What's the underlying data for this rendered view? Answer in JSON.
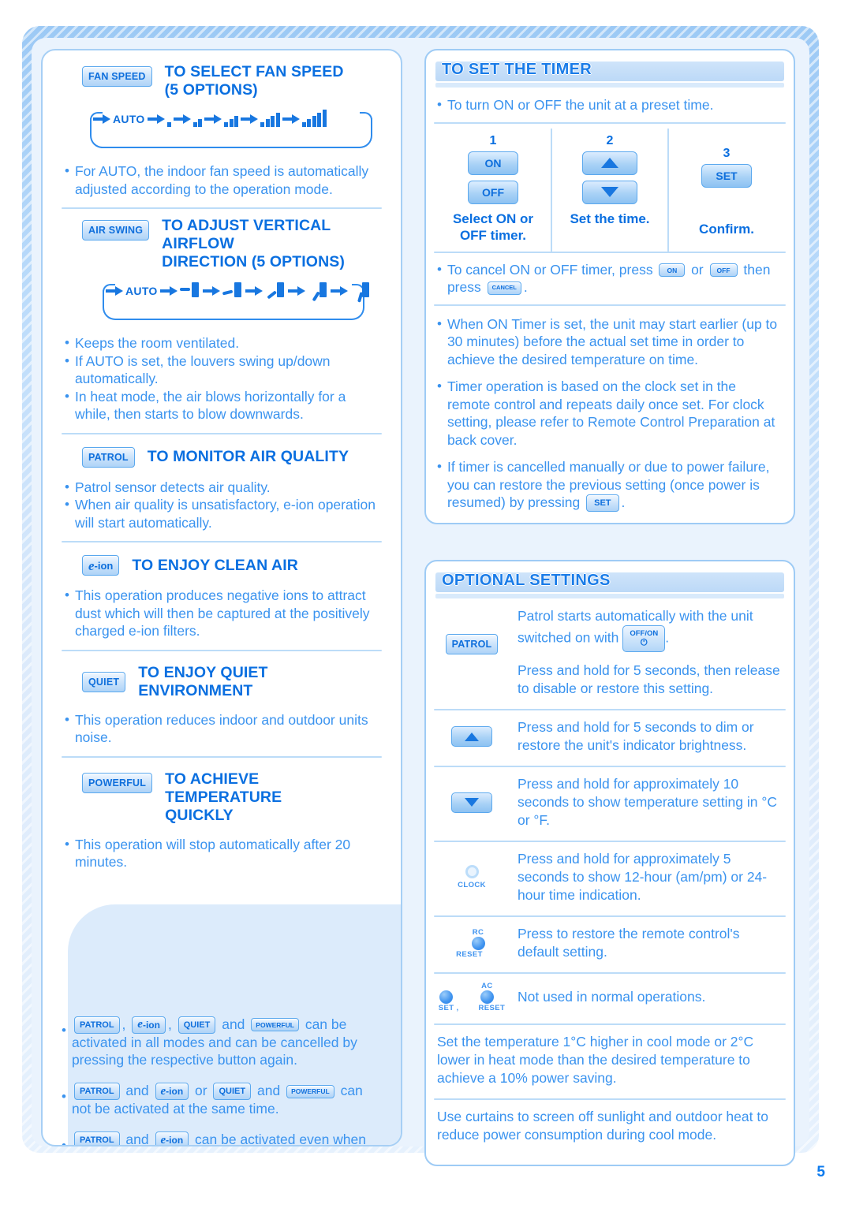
{
  "page": {
    "number": "5"
  },
  "left_column": {
    "sections": [
      {
        "id": "fan-speed",
        "button_label": "FAN SPEED",
        "heading_line1": "TO SELECT FAN SPEED",
        "heading_line2": "(5 OPTIONS)",
        "flow_auto_label": "AUTO",
        "flow_steps": 5,
        "bullets": [
          "For AUTO, the indoor fan speed is automatically adjusted according to the operation mode."
        ]
      },
      {
        "id": "air-swing",
        "button_label": "AIR SWING",
        "heading_line1": "TO ADJUST VERTICAL AIRFLOW",
        "heading_line2": "DIRECTION  (5 OPTIONS)",
        "flow_auto_label": "AUTO",
        "flow_steps": 5,
        "bullets": [
          "Keeps the room ventilated.",
          "If AUTO is set, the louvers swing up/down automatically.",
          "In heat mode, the air blows horizontally for a while, then starts to blow downwards."
        ]
      },
      {
        "id": "patrol",
        "button_label": "PATROL",
        "heading_line1": "TO MONITOR AIR QUALITY",
        "bullets": [
          "Patrol sensor detects air quality.",
          "When air quality is unsatisfactory, e-ion operation will start automatically."
        ]
      },
      {
        "id": "e-ion",
        "button_label": "e-ion",
        "heading_line1": "TO ENJOY CLEAN AIR",
        "bullets": [
          "This operation produces negative ions to attract dust which will then be captured at the positively charged e-ion filters."
        ]
      },
      {
        "id": "quiet",
        "button_label": "QUIET",
        "heading_line1": "TO ENJOY QUIET ENVIRONMENT",
        "bullets": [
          "This operation reduces indoor and outdoor units noise."
        ]
      },
      {
        "id": "powerful",
        "button_label": "POWERFUL",
        "heading_line1": "TO ACHIEVE TEMPERATURE",
        "heading_line2": "QUICKLY",
        "bullets": [
          "This operation will stop automatically after 20 minutes."
        ]
      }
    ],
    "notes": {
      "note1": {
        "btn1": "PATROL",
        "sep1": ",",
        "btn2": "e-ion",
        "sep2": ",",
        "btn3": "QUIET",
        "mid": "and",
        "btn4": "POWERFUL",
        "tail": "can be activated in all modes and can be cancelled by pressing the respective button again."
      },
      "note2": {
        "btn1": "PATROL",
        "mid1": "and",
        "btn2": "e-ion",
        "mid2": "or",
        "btn3": "QUIET",
        "mid3": "and",
        "btn4": "POWERFUL",
        "tail": "can not be activated at the same time."
      },
      "note3": {
        "btn1": "PATROL",
        "mid1": "and",
        "btn2": "e-ion",
        "tail": "can be activated even when the unit is turned off. In this condition, once e-ion indicator is ON, the unit will operate with AUTO fan speed and air swing."
      }
    }
  },
  "right_column": {
    "timer": {
      "title": "TO SET THE TIMER",
      "intro": "To turn ON or OFF the unit at a preset time.",
      "steps": [
        {
          "num": "1",
          "buttons": [
            "ON",
            "OFF"
          ],
          "caption_line1": "Select ON or",
          "caption_line2": "OFF timer."
        },
        {
          "num": "2",
          "buttons": [
            "up-arrow",
            "down-arrow"
          ],
          "caption_line1": "Set the time.",
          "caption_line2": ""
        },
        {
          "num": "3",
          "buttons": [
            "SET"
          ],
          "caption_line1": "Confirm.",
          "caption_line2": ""
        }
      ],
      "cancel_note": {
        "pre": "To cancel ON or OFF timer, press",
        "btn_on": "ON",
        "mid": "or",
        "btn_off": "OFF",
        "post": "then",
        "press": "press",
        "btn_cancel": "CANCEL",
        "period": "."
      },
      "bullets": [
        "When ON Timer is set, the unit may start earlier (up to 30 minutes) before the actual set time in order to achieve the desired temperature on time.",
        "Timer operation is based on the clock set in the remote control and repeats daily once set. For clock setting, please refer to Remote Control Preparation at back cover."
      ],
      "restore_note": {
        "pre": "If timer is cancelled manually or due to power failure, you can restore the previous setting (once power is resumed) by pressing",
        "btn_set": "SET",
        "post": "."
      }
    },
    "optional": {
      "title": "OPTIONAL SETTINGS",
      "rows": [
        {
          "icon": "patrol-button",
          "icon_label": "PATROL",
          "text_pre": "Patrol starts automatically with the unit switched on with",
          "inline_btn_line1": "OFF/ON",
          "inline_btn_glyph": "power-icon",
          "text_post": ".",
          "text_second": "Press and hold for 5 seconds, then release to disable or restore this setting."
        },
        {
          "icon": "up-arrow-button",
          "text": "Press and hold for 5 seconds to dim or restore the unit's indicator brightness."
        },
        {
          "icon": "down-arrow-button",
          "text": "Press and hold for approximately 10 seconds to show temperature setting in °C or °F."
        },
        {
          "icon": "clock-button",
          "icon_label": "CLOCK",
          "text": "Press and hold for approximately 5 seconds to show 12-hour (am/pm) or 24-hour time indication."
        },
        {
          "icon": "rc-reset-button",
          "icon_label_top": "RC",
          "icon_label_bottom": "RESET",
          "text": "Press to restore the remote control's default setting."
        },
        {
          "icon": "set-and-ac-reset-buttons",
          "icon_label_set": "SET",
          "icon_comma": ",",
          "icon_label_ac": "AC",
          "icon_label_reset": "RESET",
          "text": "Not used in normal operations."
        }
      ],
      "tips": [
        "Set the temperature 1°C higher in cool mode or 2°C lower in heat mode than the desired temperature to achieve a 10% power saving.",
        "Use curtains to screen off sunlight and outdoor heat to reduce power consumption during cool mode."
      ]
    }
  }
}
